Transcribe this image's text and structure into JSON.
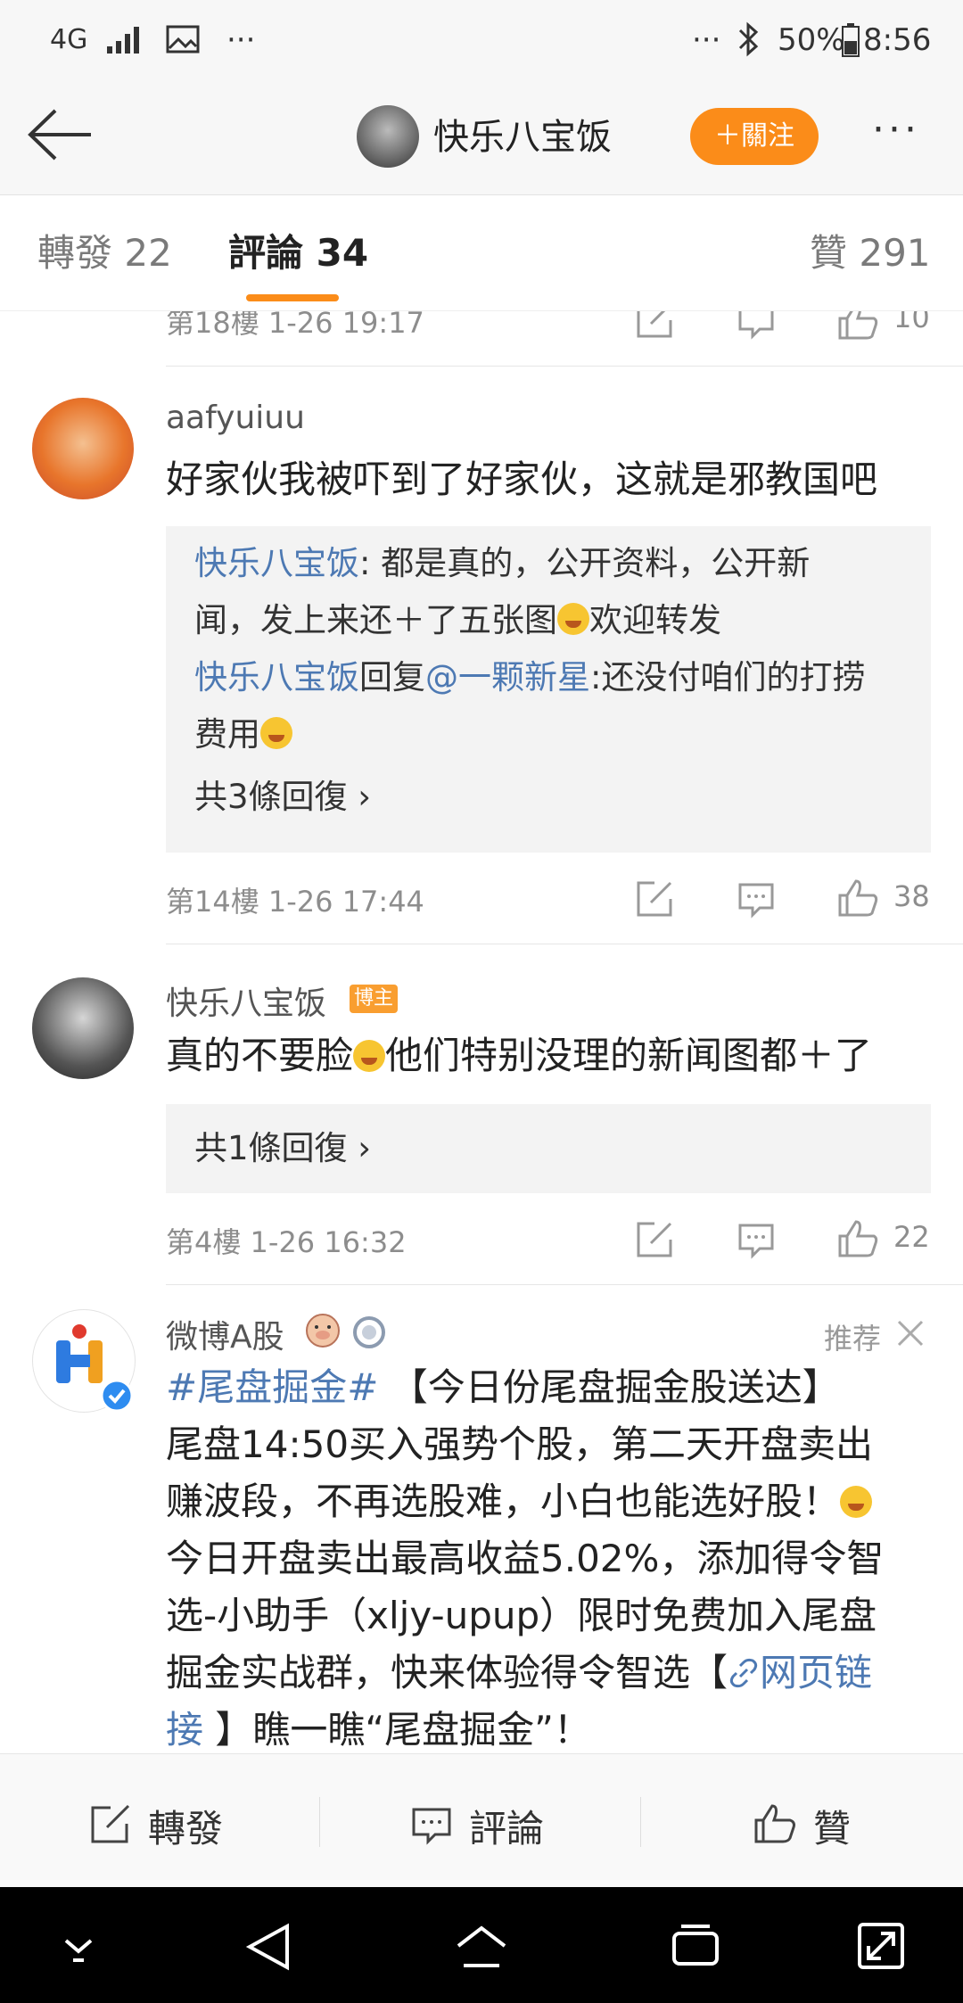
{
  "status_bar": {
    "network": "4G",
    "more": "···",
    "more_right": "···",
    "battery": "50%",
    "time": "8:56"
  },
  "header": {
    "title": "快乐八宝饭",
    "follow_label": "＋關注",
    "more": "···"
  },
  "tabs": [
    {
      "label": "轉發 22"
    },
    {
      "label": "評論 34"
    },
    {
      "label": "贊 291"
    }
  ],
  "comments": [
    {
      "floor_time": "第18樓  1-26 19:17",
      "likes": "10"
    },
    {
      "username": "aafyuiuu",
      "text": "好家伙我被吓到了好家伙，这就是邪教国吧",
      "replies": [
        {
          "author": "快乐八宝饭",
          "sep": ": ",
          "text_a": "都是真的，公开资料，公开新",
          "text_b": "闻，发上来还＋了五张图",
          "text_c": "欢迎转发"
        },
        {
          "author": "快乐八宝饭",
          "verb": "回复",
          "mention": "@一颗新星",
          "text_a": ":还没付咱们的打捞",
          "text_b": "费用"
        }
      ],
      "reply_count": "共3條回復 ›",
      "floor_time": "第14樓  1-26 17:44",
      "likes": "38"
    },
    {
      "username": "快乐八宝饭",
      "badge": "博主",
      "text_a": "真的不要脸",
      "text_b": "他们特别没理的新闻图都＋了",
      "reply_count": "共1條回復 ›",
      "floor_time": "第4樓  1-26 16:32",
      "likes": "22"
    },
    {
      "username": "微博A股",
      "recommend": "推荐",
      "hashtag": "#尾盘掘金#",
      "line1": " 【今日份尾盘掘金股送达】",
      "line2": "尾盘14:50买入强势个股，第二天开盘卖出",
      "line3": "赚波段，不再选股难，小白也能选好股！",
      "line4": "今日开盘卖出最高收益5.02%，添加得令智",
      "line5": "选-小助手（xljy-upup）限时免费加入尾盘",
      "line6": "掘金实战群，快来体验得令智选【",
      "weblink_a": "网页链",
      "weblink_b": "接",
      "line7": " 】瞧一瞧“尾盘掘金”！"
    }
  ],
  "action_bar": {
    "repost": "轉發",
    "comment": "評論",
    "like": "贊"
  },
  "colors": {
    "accent": "#fb8c19",
    "link": "#4d79b3",
    "background": "#ffffff"
  }
}
